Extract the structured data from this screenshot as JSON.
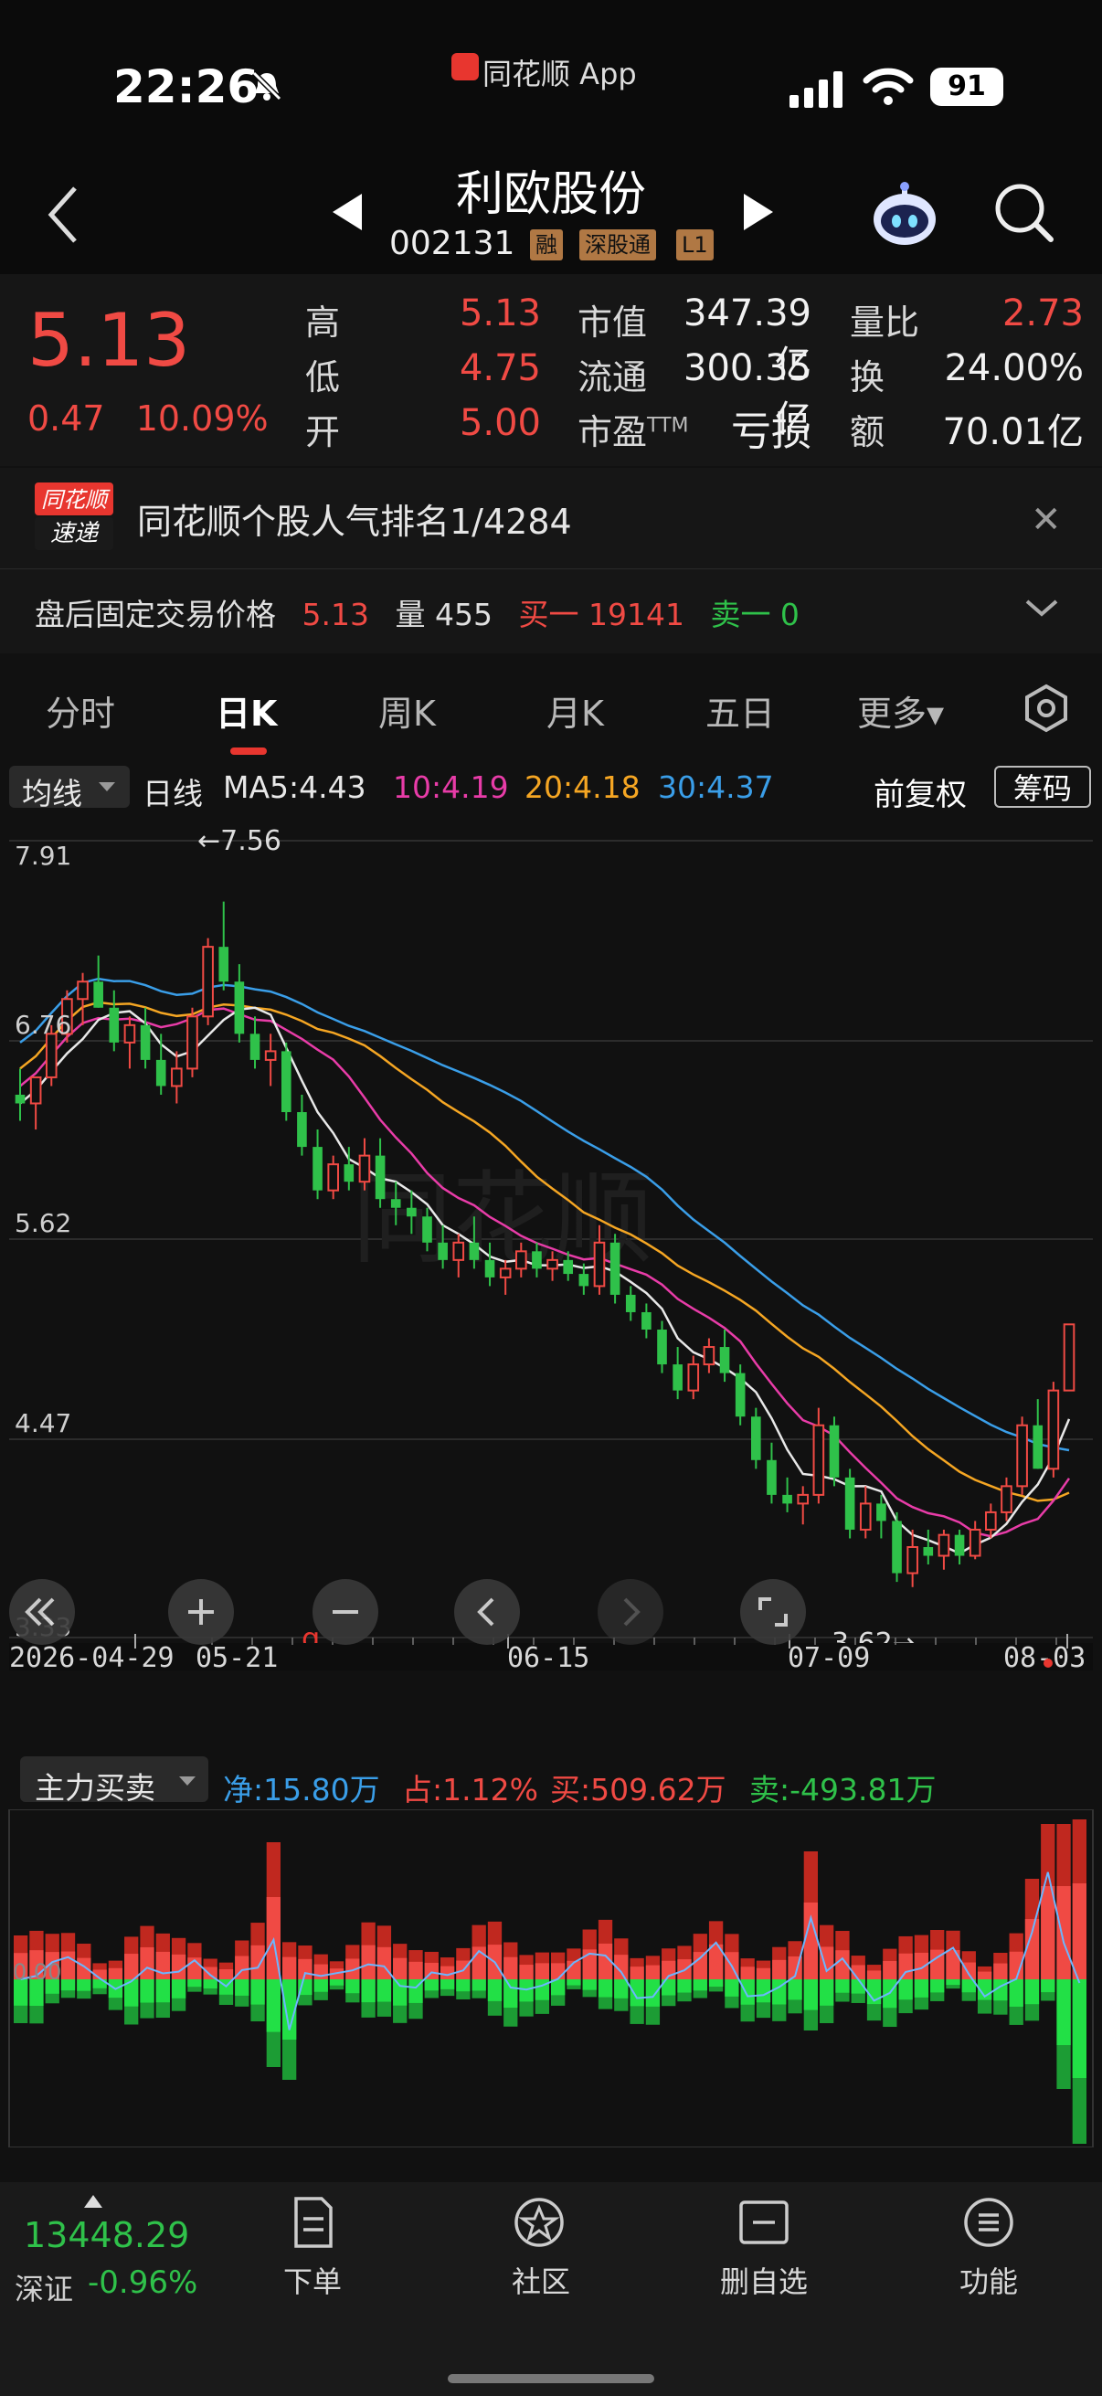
{
  "status_bar": {
    "time": "22:26",
    "app_name": "同花顺 App",
    "battery": "91"
  },
  "header": {
    "stock_name": "利欧股份",
    "stock_code": "002131",
    "tags": [
      "融",
      "深股通",
      "L1"
    ]
  },
  "quote": {
    "price": "5.13",
    "change": "0.47",
    "change_pct": "10.09%",
    "high_label": "高",
    "high": "5.13",
    "low_label": "低",
    "low": "4.75",
    "open_label": "开",
    "open": "5.00",
    "mcap_label": "市值",
    "mcap": "347.39亿",
    "float_label": "流通",
    "float_cap": "300.35亿",
    "pe_label": "市盈",
    "pe_sup": "TTM",
    "pe": "亏损",
    "vol_ratio_label": "量比",
    "vol_ratio": "2.73",
    "turnover_label": "换",
    "turnover": "24.00%",
    "amount_label": "额",
    "amount": "70.01亿"
  },
  "news": {
    "logo_top": "同花顺",
    "logo_bottom": "速递",
    "text": "同花顺个股人气排名1/4284"
  },
  "after_hours": {
    "label": "盘后固定交易价格",
    "price": "5.13",
    "vol_label": "量 455",
    "buy1": "买一 19141",
    "sell1": "卖一 0"
  },
  "tabs": [
    {
      "label": "分时"
    },
    {
      "label": "日K"
    },
    {
      "label": "周K"
    },
    {
      "label": "月K"
    },
    {
      "label": "五日"
    },
    {
      "label": "更多▾"
    }
  ],
  "ma_bar": {
    "dropdown": "均线",
    "period": "日线",
    "ma5": "MA5:4.43",
    "ma10": "10:4.19",
    "ma20": "20:4.18",
    "ma30": "30:4.37",
    "adjust": "前复权",
    "chip_button": "筹码"
  },
  "colors": {
    "up": "#f04a44",
    "down": "#2fc14a",
    "ma5": "#e8e8e8",
    "ma10": "#e83ca8",
    "ma20": "#f5a623",
    "ma30": "#3a9ee8"
  },
  "chart_data": [
    {
      "type": "candlestick",
      "y_ticks": [
        "7.91",
        "6.76",
        "5.62",
        "4.47",
        "3.33"
      ],
      "ylim": [
        3.33,
        7.91
      ],
      "x_ticks": [
        "2026-04-29",
        "05-21",
        "06-15",
        "07-09",
        "08-03"
      ],
      "annotations": {
        "max": "←7.56",
        "min": "3.62→",
        "watermark": "同花顺",
        "marker": "q"
      },
      "candles": [
        [
          6.45,
          6.6,
          6.3,
          6.4
        ],
        [
          6.4,
          6.55,
          6.25,
          6.55
        ],
        [
          6.55,
          6.85,
          6.5,
          6.8
        ],
        [
          6.8,
          7.05,
          6.75,
          7.0
        ],
        [
          7.0,
          7.15,
          6.85,
          7.1
        ],
        [
          7.1,
          7.25,
          6.95,
          6.95
        ],
        [
          6.95,
          7.05,
          6.7,
          6.75
        ],
        [
          6.75,
          6.9,
          6.6,
          6.85
        ],
        [
          6.85,
          6.95,
          6.6,
          6.65
        ],
        [
          6.65,
          6.8,
          6.45,
          6.5
        ],
        [
          6.5,
          6.7,
          6.4,
          6.6
        ],
        [
          6.6,
          6.95,
          6.55,
          6.9
        ],
        [
          6.9,
          7.35,
          6.85,
          7.3
        ],
        [
          7.3,
          7.56,
          7.05,
          7.1
        ],
        [
          7.1,
          7.2,
          6.75,
          6.8
        ],
        [
          6.8,
          6.9,
          6.6,
          6.65
        ],
        [
          6.65,
          6.8,
          6.5,
          6.7
        ],
        [
          6.7,
          6.75,
          6.3,
          6.35
        ],
        [
          6.35,
          6.45,
          6.1,
          6.15
        ],
        [
          6.15,
          6.25,
          5.85,
          5.9
        ],
        [
          5.9,
          6.1,
          5.85,
          6.05
        ],
        [
          6.05,
          6.15,
          5.9,
          5.95
        ],
        [
          5.95,
          6.2,
          5.9,
          6.1
        ],
        [
          6.1,
          6.2,
          5.8,
          5.85
        ],
        [
          5.85,
          5.95,
          5.7,
          5.8
        ],
        [
          5.8,
          5.9,
          5.65,
          5.75
        ],
        [
          5.75,
          5.8,
          5.55,
          5.6
        ],
        [
          5.6,
          5.7,
          5.45,
          5.5
        ],
        [
          5.5,
          5.65,
          5.4,
          5.6
        ],
        [
          5.6,
          5.75,
          5.45,
          5.5
        ],
        [
          5.5,
          5.6,
          5.35,
          5.4
        ],
        [
          5.4,
          5.5,
          5.3,
          5.45
        ],
        [
          5.45,
          5.6,
          5.4,
          5.55
        ],
        [
          5.55,
          5.6,
          5.4,
          5.45
        ],
        [
          5.45,
          5.55,
          5.38,
          5.5
        ],
        [
          5.5,
          5.55,
          5.38,
          5.42
        ],
        [
          5.42,
          5.48,
          5.3,
          5.35
        ],
        [
          5.35,
          5.7,
          5.3,
          5.6
        ],
        [
          5.6,
          5.65,
          5.25,
          5.3
        ],
        [
          5.3,
          5.35,
          5.15,
          5.2
        ],
        [
          5.2,
          5.25,
          5.05,
          5.1
        ],
        [
          5.1,
          5.15,
          4.85,
          4.9
        ],
        [
          4.9,
          5.0,
          4.7,
          4.75
        ],
        [
          4.75,
          4.95,
          4.7,
          4.9
        ],
        [
          4.9,
          5.05,
          4.85,
          5.0
        ],
        [
          5.0,
          5.1,
          4.8,
          4.85
        ],
        [
          4.85,
          4.9,
          4.55,
          4.6
        ],
        [
          4.6,
          4.65,
          4.3,
          4.35
        ],
        [
          4.35,
          4.45,
          4.1,
          4.15
        ],
        [
          4.15,
          4.25,
          4.05,
          4.1
        ],
        [
          4.1,
          4.2,
          3.98,
          4.15
        ],
        [
          4.15,
          4.65,
          4.1,
          4.55
        ],
        [
          4.55,
          4.6,
          4.2,
          4.25
        ],
        [
          4.25,
          4.3,
          3.9,
          3.95
        ],
        [
          3.95,
          4.2,
          3.9,
          4.1
        ],
        [
          4.1,
          4.15,
          3.9,
          4.0
        ],
        [
          4.0,
          4.05,
          3.65,
          3.7
        ],
        [
          3.7,
          3.95,
          3.62,
          3.85
        ],
        [
          3.85,
          3.95,
          3.75,
          3.8
        ],
        [
          3.8,
          3.95,
          3.72,
          3.92
        ],
        [
          3.92,
          3.95,
          3.75,
          3.8
        ],
        [
          3.8,
          4.0,
          3.78,
          3.95
        ],
        [
          3.95,
          4.1,
          3.9,
          4.05
        ],
        [
          4.05,
          4.25,
          4.0,
          4.2
        ],
        [
          4.2,
          4.6,
          4.15,
          4.55
        ],
        [
          4.55,
          4.7,
          4.3,
          4.3
        ],
        [
          4.3,
          4.8,
          4.25,
          4.75
        ],
        [
          4.75,
          5.13,
          4.75,
          5.13
        ]
      ]
    },
    {
      "type": "bar",
      "label": "主力买卖",
      "net": "净:15.80万",
      "ratio": "占:1.12%",
      "buy": "买:509.62万",
      "sell": "卖:-493.81万",
      "zero_label": "0.00"
    }
  ],
  "bottom": {
    "index_value": "13448.29",
    "index_name": "深证",
    "index_change": "-0.96%",
    "items": [
      {
        "label": "下单"
      },
      {
        "label": "社区"
      },
      {
        "label": "删自选"
      },
      {
        "label": "功能"
      }
    ]
  }
}
